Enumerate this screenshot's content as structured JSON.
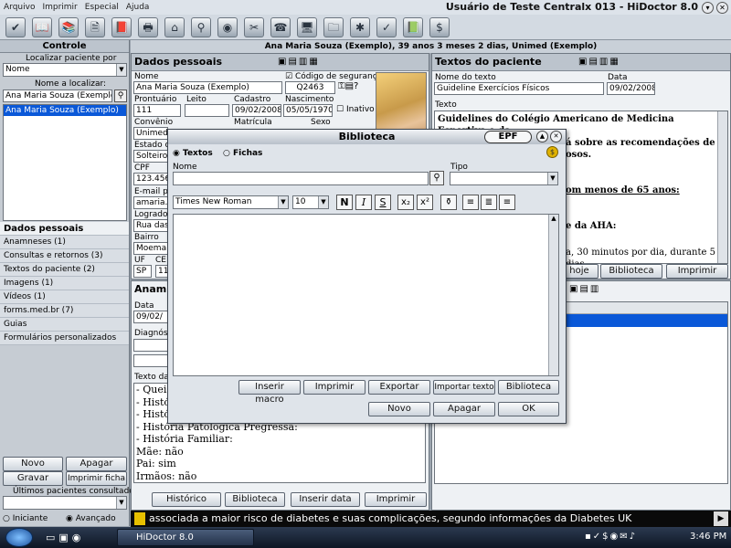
{
  "menu": [
    "Arquivo",
    "Imprimir",
    "Especial",
    "Ajuda"
  ],
  "app_title": "Usuário de Teste Centralx 013 - HiDoctor 8.0",
  "toolbar_icons": [
    "check-icon",
    "book-icon",
    "books-icon",
    "document-icon",
    "book2-icon",
    "printer-icon",
    "house-icon",
    "search-icon",
    "disk-icon",
    "tools-icon",
    "phone-icon",
    "computer-icon",
    "folder-icon",
    "asterisk-icon",
    "checkmark-circle-icon",
    "library-icon",
    "dollar-icon"
  ],
  "toolbar_glyphs": [
    "✔",
    "📖",
    "📚",
    "🗎",
    "📕",
    "🖶",
    "⌂",
    "⚲",
    "◉",
    "✂",
    "☎",
    "🖥",
    "🗀",
    "✱",
    "✓",
    "📗",
    "$"
  ],
  "patient_header": "Ana Maria Souza (Exemplo), 39 anos 3 meses 2 dias, Unimed (Exemplo)",
  "controle": {
    "title": "Controle",
    "localizar_label": "Localizar paciente por",
    "localizar_value": "Nome",
    "nome_label": "Nome a localizar:",
    "nome_value": "Ana Maria Souza (Exemplo)",
    "results": [
      "Ana Maria Souza (Exemplo)"
    ]
  },
  "sections": [
    "Dados pessoais",
    "Anamneses  (1)",
    "Consultas e retornos  (3)",
    "Textos do paciente  (2)",
    "Imagens  (1)",
    "Vídeos  (1)",
    "forms.med.br  (7)",
    "Guias",
    "Formulários personalizados"
  ],
  "left_buttons": {
    "novo": "Novo",
    "apagar": "Apagar",
    "gravar": "Gravar",
    "imprimir_ficha": "Imprimir ficha"
  },
  "ultimos_label": "Últimos pacientes consultados",
  "modes": {
    "iniciante": "Iniciante",
    "avancado": "Avançado"
  },
  "dados": {
    "title": "Dados pessoais",
    "nome_label": "Nome",
    "nome": "Ana Maria Souza (Exemplo)",
    "codigo_label": "Código de segurança",
    "codigo": "Q2463",
    "prontuario_label": "Prontuário",
    "prontuario": "111",
    "leito_label": "Leito",
    "cadastro_label": "Cadastro",
    "cadastro": "09/02/2008",
    "nascimento_label": "Nascimento",
    "nascimento": "05/05/1970",
    "inativo_label": "Inativo",
    "convenio_label": "Convênio",
    "convenio": "Unimed",
    "matricula_label": "Matrícula",
    "sexo_label": "Sexo",
    "estado_label": "Estado c",
    "estado": "Solteiro(",
    "cpf_label": "CPF",
    "cpf": "123.456.",
    "email_label": "E-mail pa",
    "email": "amaria.s",
    "logradouro_label": "Logradou",
    "logradouro": "Rua das",
    "bairro_label": "Bairro",
    "bairro": "Moema",
    "uf_label": "UF",
    "uf": "SP",
    "ce_label": "CE",
    "ce": "11"
  },
  "anamnese": {
    "title": "Anamn",
    "data_label": "Data",
    "data": "09/02/",
    "diag_label": "Diagnóst",
    "texto_label": "Texto da",
    "lines": [
      "- Quei",
      "- Histó",
      "- Histó",
      "- História Patológica Pregressa:",
      "- História Familiar:",
      "Mãe: não",
      "Pai: sim",
      "Irmãos: não"
    ],
    "buttons": [
      "Histórico",
      "Biblioteca",
      "Inserir data",
      "Imprimir"
    ]
  },
  "textos": {
    "title": "Textos do paciente",
    "nome_label": "Nome do texto",
    "nome": "Guideline Exercícios Físicos",
    "data_label": "Data",
    "data": "09/02/2008",
    "texto_label": "Texto",
    "line1": "Guidelines do Colégio Americano de Medicina Esportiva e da",
    "line2": "á sobre as recomendações de",
    "line3": "osos.",
    "line4": "om menos de 65 anos:",
    "line5": "e da AHA:",
    "line6": "a, 30 minutos por dia, durante 5 dias",
    "buttons": [
      "hoje",
      "Biblioteca",
      "Imprimir"
    ]
  },
  "dialog": {
    "title": "Biblioteca",
    "epf": "EPF",
    "radio_textos": "Textos",
    "radio_fichas": "Fichas",
    "nome_label": "Nome",
    "tipo_label": "Tipo",
    "font": "Times New Roman",
    "size": "10",
    "fmt": [
      "N",
      "I",
      "S",
      "x₂",
      "x²"
    ],
    "buttons_row1": [
      "Inserir macro",
      "Imprimir",
      "Exportar",
      "Importar texto",
      "Biblioteca"
    ],
    "buttons_row2": [
      "Novo",
      "Apagar",
      "OK"
    ]
  },
  "ticker": "associada a maior risco de diabetes e suas complicações, segundo informações da Diabetes UK",
  "taskbar": {
    "app": "HiDoctor 8.0",
    "clock": "3:46 PM"
  }
}
